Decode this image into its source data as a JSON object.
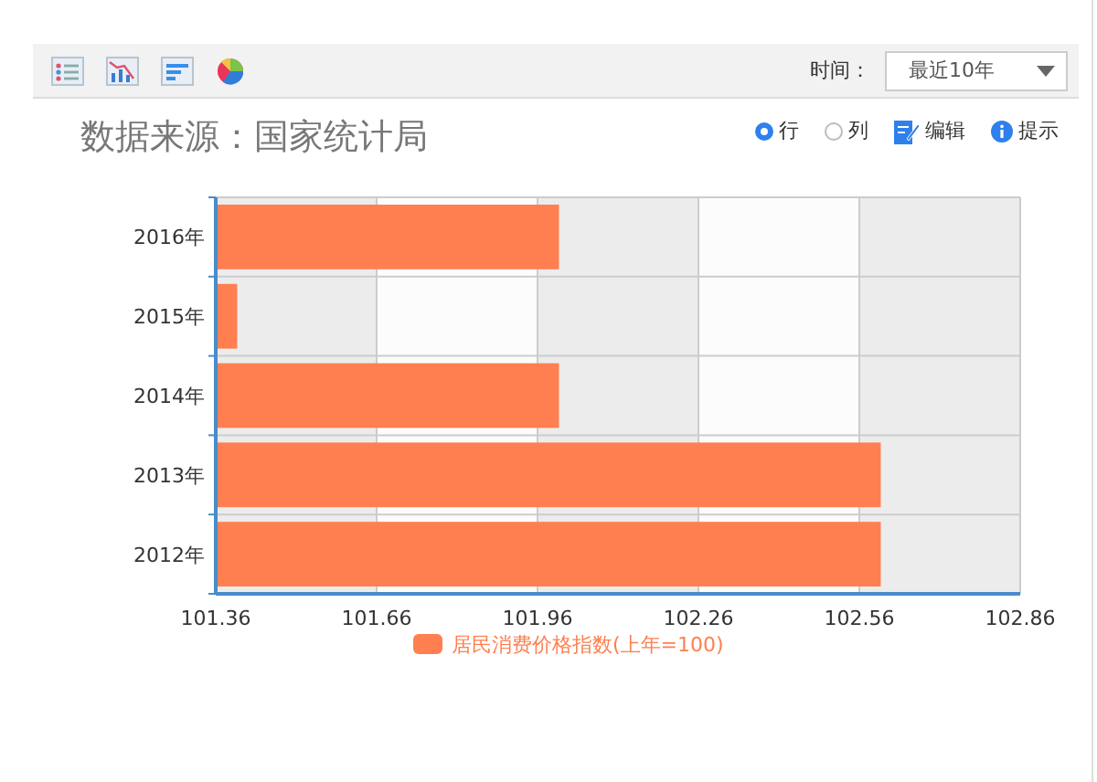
{
  "toolbar": {
    "time_label": "时间：",
    "time_select": {
      "value": "最近10年"
    }
  },
  "title": "数据来源：国家统计局",
  "options": [
    {
      "kind": "radio",
      "label": "行",
      "selected": true
    },
    {
      "kind": "radio",
      "label": "列",
      "selected": false
    },
    {
      "kind": "edit",
      "label": "编辑"
    },
    {
      "kind": "hint",
      "label": "提示"
    }
  ],
  "chart_data": {
    "type": "bar",
    "orientation": "horizontal",
    "grid": true,
    "categories": [
      "2016年",
      "2015年",
      "2014年",
      "2013年",
      "2012年"
    ],
    "series": [
      {
        "name": "居民消费价格指数(上年=100)",
        "color": "#ff7f50",
        "values": [
          102.0,
          101.4,
          102.0,
          102.6,
          102.6
        ]
      }
    ],
    "xlim": [
      101.36,
      102.86
    ],
    "xticks": [
      {
        "value": 101.36,
        "label": "101.36"
      },
      {
        "value": 101.66,
        "label": "101.66"
      },
      {
        "value": 101.96,
        "label": "101.96"
      },
      {
        "value": 102.26,
        "label": "102.26"
      },
      {
        "value": 102.56,
        "label": "102.56"
      },
      {
        "value": 102.86,
        "label": "102.86"
      }
    ]
  }
}
